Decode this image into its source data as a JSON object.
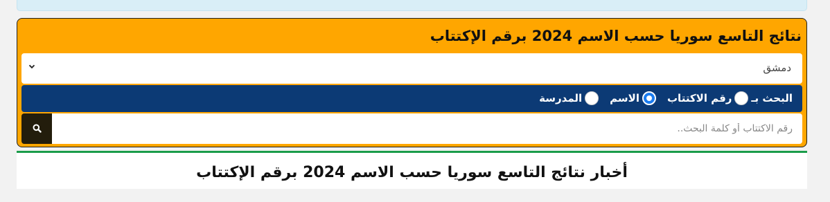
{
  "search_card": {
    "title": "نتائج التاسع سوريا حسب الاسم 2024 برقم الإكتتاب",
    "city_select": {
      "value": "دمشق"
    },
    "search_by": {
      "label": "البحث بـ",
      "options": [
        {
          "label": "رقم الاكتتاب",
          "checked": false
        },
        {
          "label": "الاسم",
          "checked": true
        },
        {
          "label": "المدرسة",
          "checked": false
        }
      ]
    },
    "query": {
      "placeholder": "رقم الاكتتاب أو كلمة البحث..",
      "value": ""
    },
    "search_button_icon": "search-icon"
  },
  "news": {
    "title": "أخبار نتائج التاسع سوريا حسب الاسم 2024 برقم الإكتتاب"
  },
  "colors": {
    "card_bg": "#ffa600",
    "search_by_bg": "#0c3a75",
    "radio_checked": "#1a7cf0",
    "search_button_bg": "#231d0c",
    "news_accent": "#1a9c4a",
    "info_strip": "#d9eef7"
  }
}
